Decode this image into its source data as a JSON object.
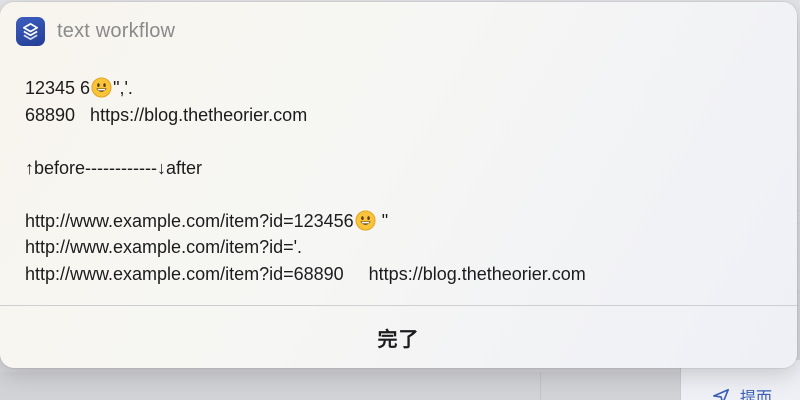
{
  "dialog": {
    "app_icon": "shortcuts-icon",
    "title": "text workflow",
    "lines": {
      "l1_a": "12345 6",
      "l1_b": "\",'.",
      "l2": "68890   https://blog.thetheorier.com",
      "l4": "↑before------------↓after",
      "l6_a": "http://www.example.com/item?id=123456",
      "l6_b": " \"",
      "l7": "http://www.example.com/item?id='.",
      "l8": "http://www.example.com/item?id=68890     https://blog.thetheorier.com"
    },
    "emoji_icon": "smiley-emoji-icon",
    "done_label": "完了"
  },
  "background": {
    "send_label": "提而",
    "send_icon": "send-arrow-icon",
    "accent_color": "#3a5fb8"
  }
}
